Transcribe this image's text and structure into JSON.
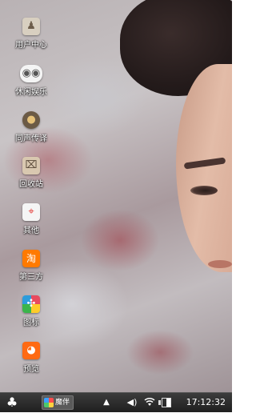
{
  "desktop": {
    "icons": [
      {
        "label": "用户中心",
        "icon": "user-center-icon",
        "color": "#d8cfc0",
        "glyph": "♟"
      },
      {
        "label": "休闲娱乐",
        "icon": "gamepad-icon",
        "color": "#ffffff",
        "glyph": "🎮"
      },
      {
        "label": "同声传译",
        "icon": "interpreter-icon",
        "color": "#8a6a3a",
        "glyph": "●"
      },
      {
        "label": "回收站",
        "icon": "recycle-bin-icon",
        "color": "#c8b7a0",
        "glyph": "🗑"
      },
      {
        "label": "其他",
        "icon": "map-pin-icon",
        "color": "#4caf50",
        "glyph": "⌖"
      },
      {
        "label": "第三方",
        "icon": "taobao-icon",
        "color": "#ff7a00",
        "glyph": "淘"
      },
      {
        "label": "图标",
        "icon": "pinwheel-icon",
        "color": "#e84a5f",
        "glyph": "✣"
      },
      {
        "label": "预览",
        "icon": "uc-browser-icon",
        "color": "#ff6a13",
        "glyph": "◕"
      }
    ]
  },
  "taskbar": {
    "start_icon": "clover-icon",
    "task_label": "魔伴",
    "tray_up_arrow": "▲",
    "volume_glyph": "🔊",
    "wifi_glyph": "📶",
    "battery_level": 0.5,
    "clock": "17:12:32"
  }
}
